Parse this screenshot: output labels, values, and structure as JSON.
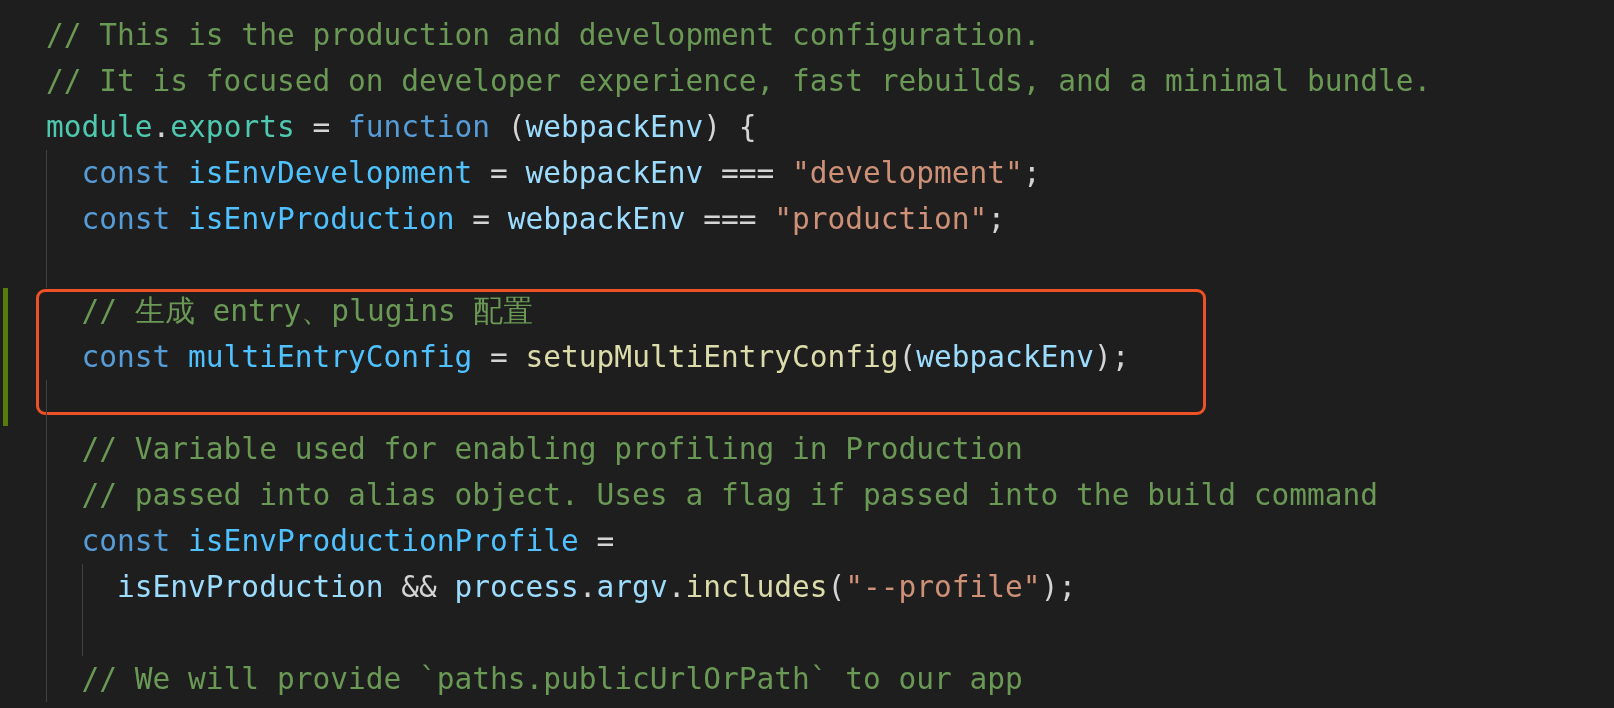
{
  "editor": {
    "lines": [
      {
        "kind": "code",
        "changed": false,
        "tokens": [
          {
            "kind": "comment",
            "text": "// This is the production and development configuration."
          }
        ]
      },
      {
        "kind": "code",
        "changed": false,
        "tokens": [
          {
            "kind": "comment",
            "text": "// It is focused on developer experience, fast rebuilds, and a minimal bundle."
          }
        ]
      },
      {
        "kind": "code",
        "changed": false,
        "tokens": [
          {
            "kind": "type",
            "text": "module"
          },
          {
            "kind": "plain",
            "text": "."
          },
          {
            "kind": "type",
            "text": "exports"
          },
          {
            "kind": "plain",
            "text": " = "
          },
          {
            "kind": "keyword",
            "text": "function"
          },
          {
            "kind": "plain",
            "text": " ("
          },
          {
            "kind": "variable",
            "text": "webpackEnv"
          },
          {
            "kind": "plain",
            "text": ") {"
          }
        ]
      },
      {
        "kind": "code",
        "changed": false,
        "tokens": [
          {
            "kind": "keyword",
            "text": "  const "
          },
          {
            "kind": "constant",
            "text": "isEnvDevelopment"
          },
          {
            "kind": "plain",
            "text": " = "
          },
          {
            "kind": "variable",
            "text": "webpackEnv"
          },
          {
            "kind": "plain",
            "text": " === "
          },
          {
            "kind": "string",
            "text": "\"development\""
          },
          {
            "kind": "plain",
            "text": ";"
          }
        ]
      },
      {
        "kind": "code",
        "changed": false,
        "tokens": [
          {
            "kind": "keyword",
            "text": "  const "
          },
          {
            "kind": "constant",
            "text": "isEnvProduction"
          },
          {
            "kind": "plain",
            "text": " = "
          },
          {
            "kind": "variable",
            "text": "webpackEnv"
          },
          {
            "kind": "plain",
            "text": " === "
          },
          {
            "kind": "string",
            "text": "\"production\""
          },
          {
            "kind": "plain",
            "text": ";"
          }
        ]
      },
      {
        "kind": "blank",
        "changed": false
      },
      {
        "kind": "boxed",
        "lines": [
          {
            "kind": "code",
            "changed": true,
            "tokens": [
              {
                "kind": "comment",
                "text": "  // 生成 entry、plugins 配置"
              }
            ]
          },
          {
            "kind": "code",
            "changed": true,
            "tokens": [
              {
                "kind": "keyword",
                "text": "  const "
              },
              {
                "kind": "constant",
                "text": "multiEntryConfig"
              },
              {
                "kind": "plain",
                "text": " = "
              },
              {
                "kind": "function",
                "text": "setupMultiEntryConfig"
              },
              {
                "kind": "plain",
                "text": "("
              },
              {
                "kind": "variable",
                "text": "webpackEnv"
              },
              {
                "kind": "plain",
                "text": ");"
              }
            ]
          }
        ]
      },
      {
        "kind": "blank",
        "changed": true
      },
      {
        "kind": "code",
        "changed": false,
        "tokens": [
          {
            "kind": "comment",
            "text": "  // Variable used for enabling profiling in Production"
          }
        ]
      },
      {
        "kind": "code",
        "changed": false,
        "tokens": [
          {
            "kind": "comment",
            "text": "  // passed into alias object. Uses a flag if passed into the build command"
          }
        ]
      },
      {
        "kind": "code",
        "changed": false,
        "tokens": [
          {
            "kind": "keyword",
            "text": "  const "
          },
          {
            "kind": "constant",
            "text": "isEnvProductionProfile"
          },
          {
            "kind": "plain",
            "text": " ="
          }
        ]
      },
      {
        "kind": "code",
        "changed": false,
        "tokens": [
          {
            "kind": "variable",
            "text": "    isEnvProduction"
          },
          {
            "kind": "plain",
            "text": " && "
          },
          {
            "kind": "variable",
            "text": "process"
          },
          {
            "kind": "plain",
            "text": "."
          },
          {
            "kind": "variable",
            "text": "argv"
          },
          {
            "kind": "plain",
            "text": "."
          },
          {
            "kind": "function",
            "text": "includes"
          },
          {
            "kind": "plain",
            "text": "("
          },
          {
            "kind": "string",
            "text": "\"--profile\""
          },
          {
            "kind": "plain",
            "text": ");"
          }
        ]
      },
      {
        "kind": "blank",
        "changed": false
      },
      {
        "kind": "code",
        "changed": false,
        "tokens": [
          {
            "kind": "comment",
            "text": "  // We will provide `paths.publicUrlOrPath` to our app"
          }
        ]
      }
    ]
  }
}
